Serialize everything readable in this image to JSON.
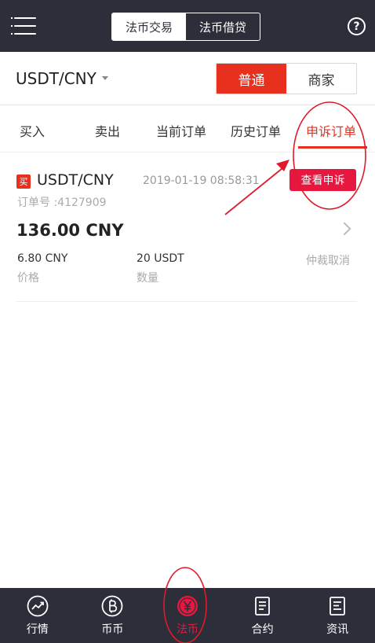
{
  "header": {
    "segments": [
      "法币交易",
      "法币借贷"
    ],
    "active_segment": 0
  },
  "pair_bar": {
    "pair": "USDT/CNY",
    "modes": [
      "普通",
      "商家"
    ]
  },
  "tabs": [
    {
      "label": "买入"
    },
    {
      "label": "卖出"
    },
    {
      "label": "当前订单"
    },
    {
      "label": "历史订单"
    },
    {
      "label": "申诉订单"
    }
  ],
  "order": {
    "side_tag": "买",
    "pair": "USDT/CNY",
    "time": "2019-01-19 08:58:31",
    "appeal_button": "查看申诉",
    "order_no": "订单号 :4127909",
    "amount": "136.00 CNY",
    "price_value": "6.80 CNY",
    "price_label": "价格",
    "qty_value": "20 USDT",
    "qty_label": "数量",
    "status": "仲裁取消"
  },
  "bottom_nav": [
    {
      "label": "行情",
      "icon": "trend-chart-icon"
    },
    {
      "label": "币币",
      "icon": "bitcoin-icon"
    },
    {
      "label": "法币",
      "icon": "yuan-coin-icon"
    },
    {
      "label": "合约",
      "icon": "contract-doc-icon"
    },
    {
      "label": "资讯",
      "icon": "news-doc-icon"
    }
  ],
  "colors": {
    "accent_red": "#e8301e",
    "appeal_red": "#e8173f",
    "dark_bar": "#2c2f3a",
    "annotation_red": "#e01a2b"
  }
}
